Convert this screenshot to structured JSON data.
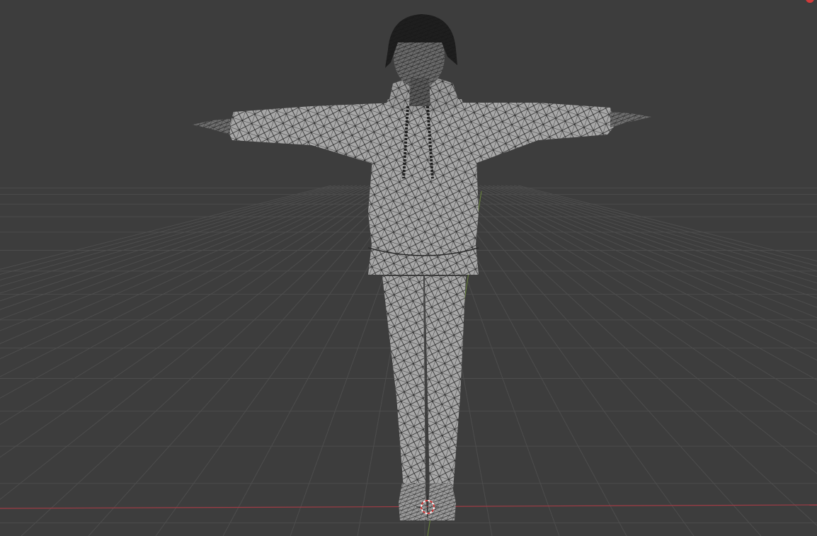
{
  "viewport": {
    "background_color": "#3d3d3d",
    "grid_line_color": "#4d4d4d",
    "x_axis_color": "#a03c45",
    "y_axis_color": "#7ea63a",
    "grid_visible": true,
    "view_mode": "wireframe-overlay"
  },
  "model": {
    "pose": "T-pose",
    "mesh_color": "#a7a7a7",
    "wire_color": "#1a1a1a",
    "parts": [
      "hair",
      "head",
      "hood",
      "hoodie-torso",
      "left-sleeve",
      "right-sleeve",
      "left-hand",
      "right-hand",
      "drawstring-left",
      "drawstring-right",
      "left-leg",
      "right-leg",
      "left-shoe",
      "right-shoe"
    ]
  },
  "icons": {
    "cursor": "3d-cursor-icon",
    "corner": "corner-indicator-icon"
  }
}
